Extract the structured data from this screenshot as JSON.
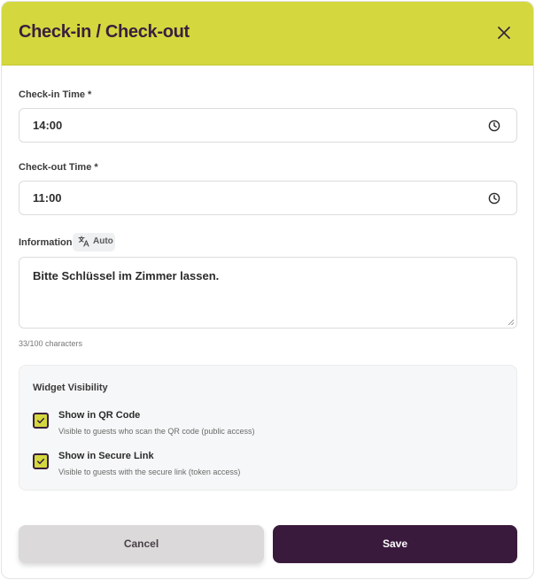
{
  "modal": {
    "title": "Check-in / Check-out",
    "header_color": "#d4d83e",
    "close_icon": "close-icon"
  },
  "checkin": {
    "label": "Check-in Time *",
    "value": "14:00",
    "icon": "clock-icon"
  },
  "checkout": {
    "label": "Check-out Time *",
    "value": "11:00",
    "icon": "clock-icon"
  },
  "information": {
    "label": "Information",
    "badge_icon": "translate-icon",
    "badge_text": "Auto",
    "value": "Bitte Schlüssel im Zimmer lassen.",
    "char_count": "33/100 characters"
  },
  "visibility": {
    "title": "Widget Visibility",
    "options": [
      {
        "label": "Show in QR Code",
        "description": "Visible to guests who scan the QR code (public access)",
        "checked": true
      },
      {
        "label": "Show in Secure Link",
        "description": "Visible to guests with the secure link (token access)",
        "checked": true
      }
    ]
  },
  "actions": {
    "cancel_label": "Cancel",
    "save_label": "Save",
    "save_color": "#3a1a3c"
  }
}
